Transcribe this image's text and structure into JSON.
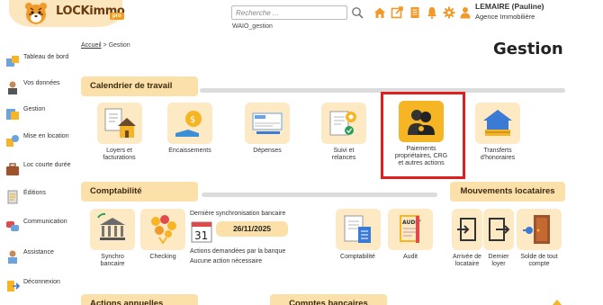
{
  "header": {
    "logo_text": "LOCKimmo",
    "logo_badge": "pro",
    "search_placeholder": "Recherche ...",
    "subtitle": "WAIO_gestion",
    "user_name": "LEMAIRE (Pauline)",
    "user_org": "Agence Immobilière"
  },
  "sidebar": {
    "items": [
      {
        "label": "Tableau de bord",
        "icon": "dashboard-icon"
      },
      {
        "label": "Vos données",
        "icon": "person-icon"
      },
      {
        "label": "Gestion",
        "icon": "management-icon"
      },
      {
        "label": "Mise en location",
        "icon": "rental-icon"
      },
      {
        "label": "Loc courte durée",
        "icon": "suitcase-icon"
      },
      {
        "label": "Éditions",
        "icon": "editions-icon"
      },
      {
        "label": "Communication",
        "icon": "communication-icon"
      },
      {
        "label": "Assistance",
        "icon": "assistance-icon"
      },
      {
        "label": "Déconnexion",
        "icon": "logout-icon"
      }
    ]
  },
  "breadcrumb": {
    "home": "Accueil",
    "separator": ">",
    "current": "Gestion"
  },
  "page_title": "Gestion",
  "calendar": {
    "title": "Calendrier de travail",
    "tiles": [
      {
        "l1": "Loyers et",
        "l2": "facturations",
        "l3": ""
      },
      {
        "l1": "Encaissements",
        "l2": "",
        "l3": ""
      },
      {
        "l1": "Dépenses",
        "l2": "",
        "l3": ""
      },
      {
        "l1": "Suivi et",
        "l2": "relances",
        "l3": ""
      },
      {
        "l1": "Paiements",
        "l2": "propriétaires, CRG",
        "l3": "et autres actions"
      },
      {
        "l1": "Transferts",
        "l2": "d'honoraires",
        "l3": ""
      }
    ]
  },
  "comptabilite": {
    "title": "Comptabilité",
    "sync_label": "Dernière synchronisation bancaire",
    "sync_date": "26/11/2025",
    "calendar_day": "31",
    "actions_label": "Actions demandées par la banque",
    "actions_value": "Aucune action nécessaire",
    "tiles": [
      {
        "l1": "Synchro",
        "l2": "bancaire"
      },
      {
        "l1": "Checking",
        "l2": ""
      },
      {
        "l1": "Comptabilité",
        "l2": ""
      },
      {
        "l1": "Audit",
        "l2": ""
      }
    ],
    "audit_label": "AUDIT"
  },
  "mouvements": {
    "title": "Mouvements locataires",
    "tiles": [
      {
        "l1": "Arrivée de",
        "l2": "locataire"
      },
      {
        "l1": "Dernier",
        "l2": "loyer"
      },
      {
        "l1": "Solde de tout",
        "l2": "compte"
      }
    ]
  },
  "bottom": {
    "actions_title": "Actions annuelles",
    "comptes_title": "Comptes bancaires"
  },
  "colors": {
    "accent": "#f5b524",
    "section_bg": "#fbe1a9",
    "highlight": "#e02020"
  }
}
